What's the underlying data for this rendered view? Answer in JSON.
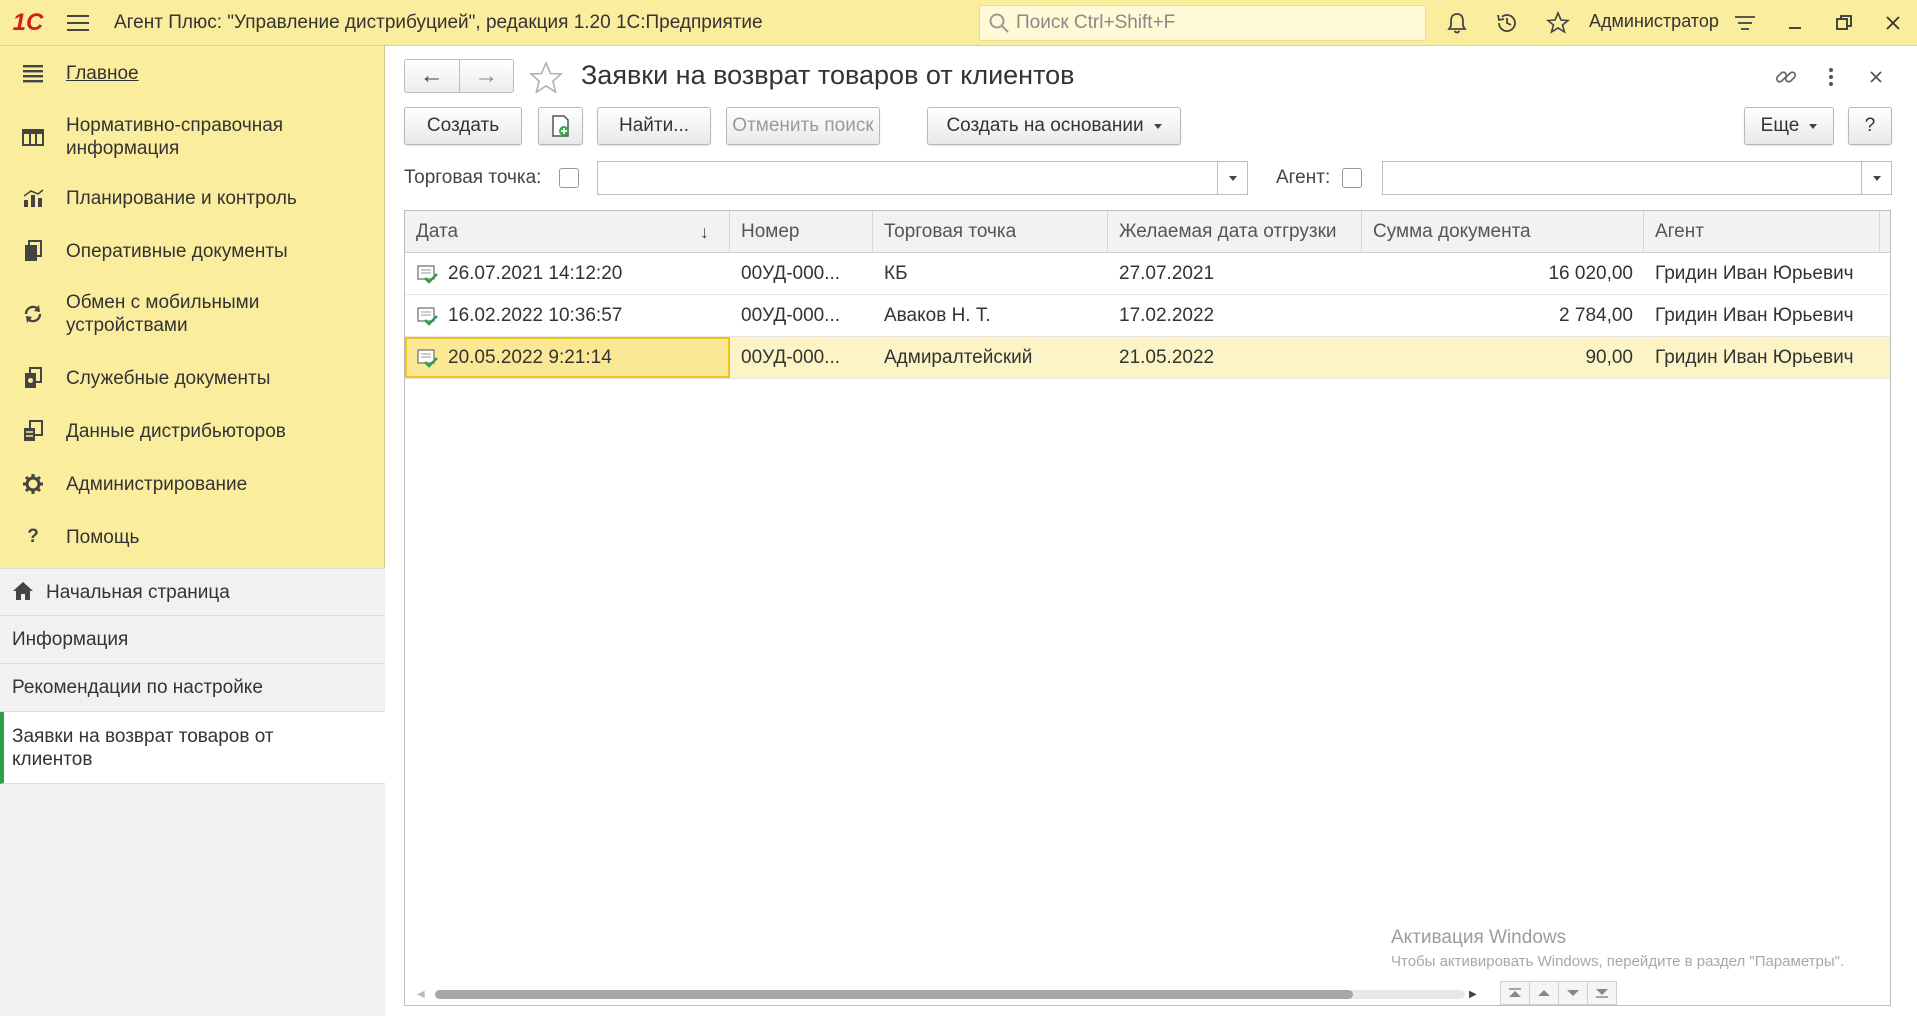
{
  "titlebar": {
    "logo": "1С",
    "app_title": "Агент Плюс: \"Управление дистрибуцией\", редакция 1.20 1С:Предприятие",
    "search_placeholder": "Поиск Ctrl+Shift+F",
    "user": "Администратор"
  },
  "sidebar": {
    "items": [
      {
        "label": "Главное",
        "icon": "menu-lines-icon"
      },
      {
        "label": "Нормативно-справочная информация",
        "icon": "catalog-icon"
      },
      {
        "label": "Планирование и контроль",
        "icon": "bar-chart-icon"
      },
      {
        "label": "Оперативные документы",
        "icon": "documents-icon"
      },
      {
        "label": "Обмен с мобильными устройствами",
        "icon": "sync-icon"
      },
      {
        "label": "Служебные документы",
        "icon": "service-docs-icon"
      },
      {
        "label": "Данные дистрибьюторов",
        "icon": "distributor-data-icon"
      },
      {
        "label": "Администрирование",
        "icon": "gear-icon"
      },
      {
        "label": "Помощь",
        "icon": "question-icon"
      }
    ],
    "open_windows": [
      {
        "label": "Начальная страница",
        "icon": "home-icon"
      },
      {
        "label": "Информация"
      },
      {
        "label": "Рекомендации по настройке"
      },
      {
        "label": "Заявки на возврат товаров от клиентов"
      }
    ]
  },
  "main": {
    "title": "Заявки на возврат товаров от клиентов",
    "toolbar": {
      "create": "Создать",
      "find": "Найти...",
      "cancel_search": "Отменить поиск",
      "create_based_on": "Создать на основании",
      "more": "Еще",
      "help": "?"
    },
    "filters": {
      "outlet_label": "Торговая точка:",
      "agent_label": "Агент:"
    },
    "table": {
      "columns": [
        "Дата",
        "Номер",
        "Торговая точка",
        "Желаемая дата отгрузки",
        "Сумма документа",
        "Агент"
      ],
      "sort_indicator": "↓",
      "rows": [
        {
          "date": "26.07.2021 14:12:20",
          "number": "00УД-000...",
          "outlet": "КБ",
          "ship_date": "27.07.2021",
          "sum": "16 020,00",
          "agent": "Гридин Иван Юрьевич"
        },
        {
          "date": "16.02.2022 10:36:57",
          "number": "00УД-000...",
          "outlet": "Аваков Н. Т.",
          "ship_date": "17.02.2022",
          "sum": "2 784,00",
          "agent": "Гридин Иван Юрьевич"
        },
        {
          "date": "20.05.2022 9:21:14",
          "number": "00УД-000...",
          "outlet": "Адмиралтейский",
          "ship_date": "21.05.2022",
          "sum": "90,00",
          "agent": "Гридин Иван Юрьевич"
        }
      ],
      "selected_row": 2
    },
    "watermark": {
      "line1": "Активация Windows",
      "line2": "Чтобы активировать Windows, перейдите в раздел \"Параметры\"."
    }
  },
  "colors": {
    "panel_yellow": "#fbed9e",
    "selected_row": "#fcf4c6",
    "focus_cell": "#f2c417",
    "active_marker": "#2e9e48",
    "logo_red": "#d0201e"
  }
}
